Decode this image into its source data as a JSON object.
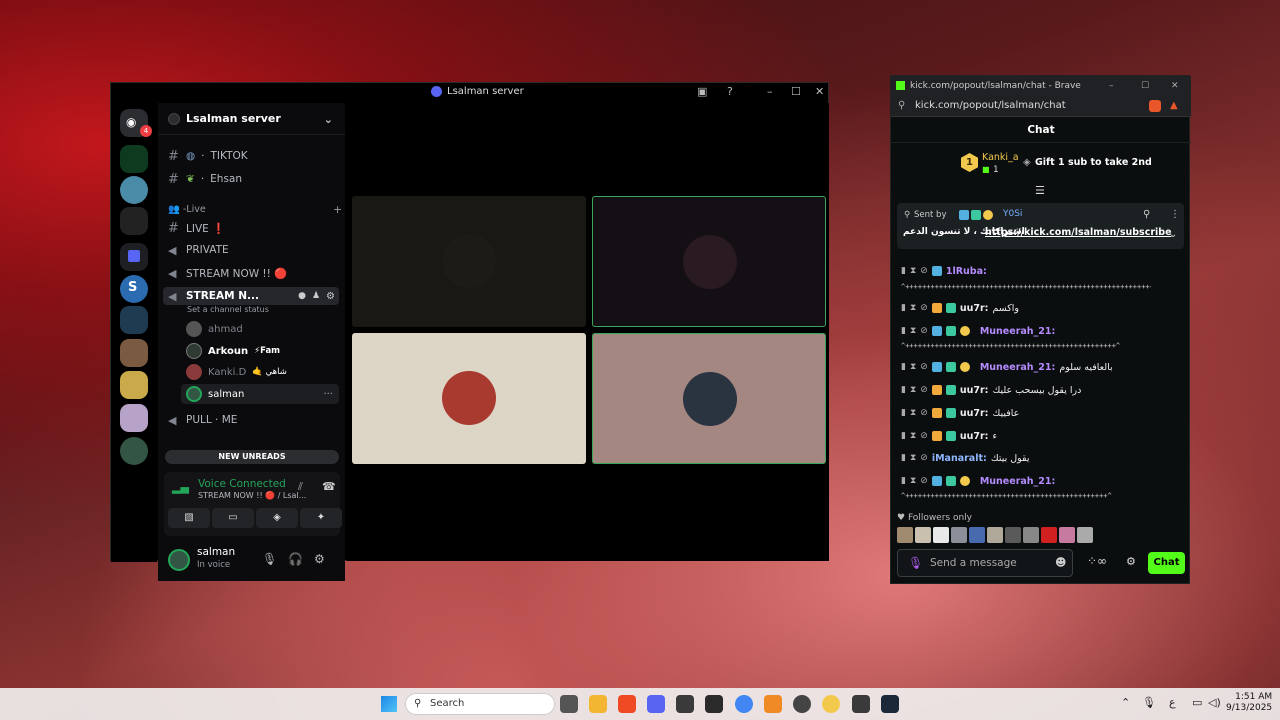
{
  "discord": {
    "title": "Lsalman server",
    "notif_badge": "4",
    "server_name": "Lsalman server",
    "channels": [
      {
        "name": "TIKTOK",
        "prefix": "· "
      },
      {
        "name": "Ehsan",
        "prefix": "· "
      }
    ],
    "category_live": "-Live",
    "live_channels": {
      "live": "LIVE ❗",
      "private": "PRIVATE",
      "stream_now": "STREAM NOW !! 🔴",
      "stream_active": "STREAM N...",
      "channel_status": "Set a channel status",
      "pull_me": "PULL · ME"
    },
    "voice_users": [
      {
        "name": "ahmad",
        "tag": ""
      },
      {
        "name": "Arkoun",
        "tag": "⚡Fam"
      },
      {
        "name": "Kanki.D",
        "tag": "🤙 شاهي"
      },
      {
        "name": "salman",
        "tag": ""
      }
    ],
    "new_unreads": "NEW UNREADS",
    "voice_connected": "Voice Connected",
    "voice_sub": "STREAM NOW !! 🔴 / Lsal...",
    "user": {
      "name": "salman",
      "status": "In voice"
    }
  },
  "kick": {
    "window_title": "kick.com/popout/lsalman/chat - Brave",
    "url": "kick.com/popout/lsalman/chat",
    "header": "Chat",
    "top_gifter": {
      "rank": "1",
      "name": "Kanki_a",
      "count": "1"
    },
    "gift_cta": "Gift 1 sub to take 2nd",
    "pinned": {
      "sent_by_label": "Sent by",
      "sender": "Y0Si",
      "text_ar": "اشتراكاتك ، لا تنسون الدعم",
      "link": "https://kick.com/lsalman/subscribe"
    },
    "messages": [
      {
        "user": "1lRuba:",
        "text": "",
        "color": "#b58cff"
      },
      {
        "user": "uu7r:",
        "text": "واكسم",
        "color": "#eeeeee"
      },
      {
        "user": "Muneerah_21:",
        "text": "",
        "color": "#b58cff"
      },
      {
        "user": "Muneerah_21:",
        "text": "بالعافيه سلوم",
        "color": "#b58cff"
      },
      {
        "user": "uu7r:",
        "text": "درا يقول بيسحب عليك",
        "color": "#eeeeee"
      },
      {
        "user": "uu7r:",
        "text": "عافييك",
        "color": "#eeeeee"
      },
      {
        "user": "uu7r:",
        "text": "ء",
        "color": "#eeeeee"
      },
      {
        "user": "iManaralt:",
        "text": "يقول بيتك",
        "color": "#8fb7ff"
      },
      {
        "user": "Muneerah_21:",
        "text": "",
        "color": "#b58cff"
      }
    ],
    "followers_only": "Followers only",
    "input_placeholder": "Send a message",
    "chat_button": "Chat"
  },
  "taskbar": {
    "search_label": "Search",
    "time": "1:51 AM",
    "date": "9/13/2025",
    "lang": "ع"
  }
}
